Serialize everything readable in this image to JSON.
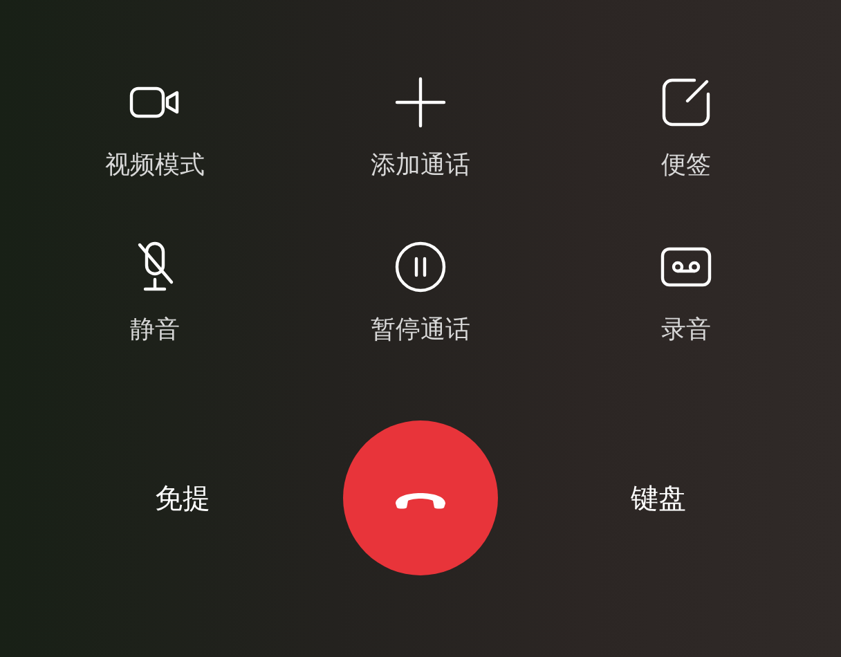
{
  "controls": [
    {
      "kind": "video",
      "label": "视频模式"
    },
    {
      "kind": "add",
      "label": "添加通话"
    },
    {
      "kind": "note",
      "label": "便签"
    },
    {
      "kind": "mute",
      "label": "静音"
    },
    {
      "kind": "hold",
      "label": "暂停通话"
    },
    {
      "kind": "record",
      "label": "录音"
    }
  ],
  "bottom": {
    "left": "免提",
    "right": "键盘"
  }
}
